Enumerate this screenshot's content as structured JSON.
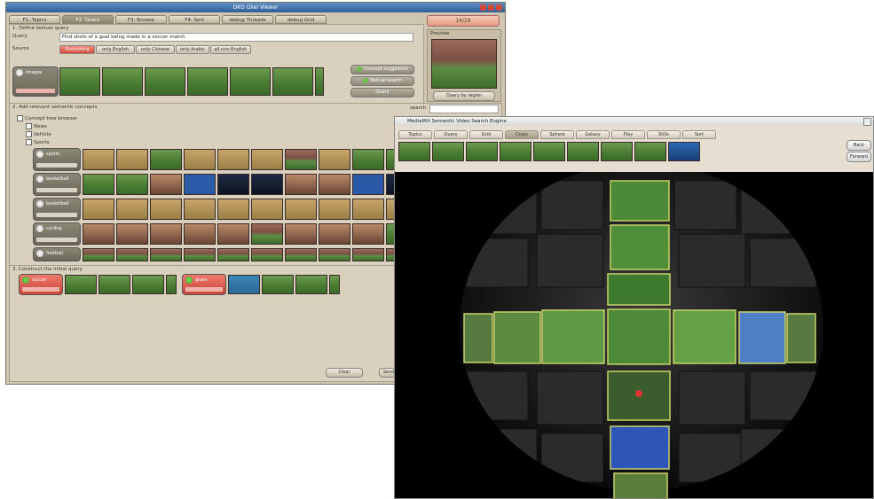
{
  "win1": {
    "title": "DKG Gliel Viewer",
    "tabs": [
      "F1: Topics",
      "F2: Query",
      "F3: Browse",
      "F4: Sort",
      "debug Threads",
      "debug Grid"
    ],
    "active_tab": 1,
    "counter": "14/28",
    "section1": "1. Define textual query",
    "query_label": "Query",
    "query_value": "Find shots of a goal being made in a soccer match",
    "source_label": "Source",
    "source_buttons": [
      "Everything",
      "only English",
      "only Chinese",
      "only Arabic",
      "all non-English"
    ],
    "images_label": "Images",
    "concept_suggestion": "Concept suggestion",
    "textual_search": "Textual search",
    "query_button": "Query",
    "preview_label": "Preview",
    "query_by_region": "Query by region",
    "section2": "2. Add relevant semantic concepts",
    "search_label": "search",
    "tree_root": "Concept tree browser",
    "tree_items": [
      "News",
      "Vehicle",
      "Sports"
    ],
    "concepts": [
      "sports",
      "basketball",
      "basketball",
      "cycling",
      "football"
    ],
    "section3": "3. Construct the initial query",
    "query_concepts": [
      "soccer",
      "grass"
    ],
    "clear_button": "Clear",
    "send_button": "Send"
  },
  "win2": {
    "title": "MediaMill Semantic Video Search Engine",
    "tabs": [
      "Topics",
      "Query",
      "Grid",
      "Cross",
      "Sphere",
      "Galaxy",
      "Play",
      "Stills",
      "Sort"
    ],
    "active_tab": 3,
    "back_button": "Back",
    "forward_button": "Forward"
  }
}
